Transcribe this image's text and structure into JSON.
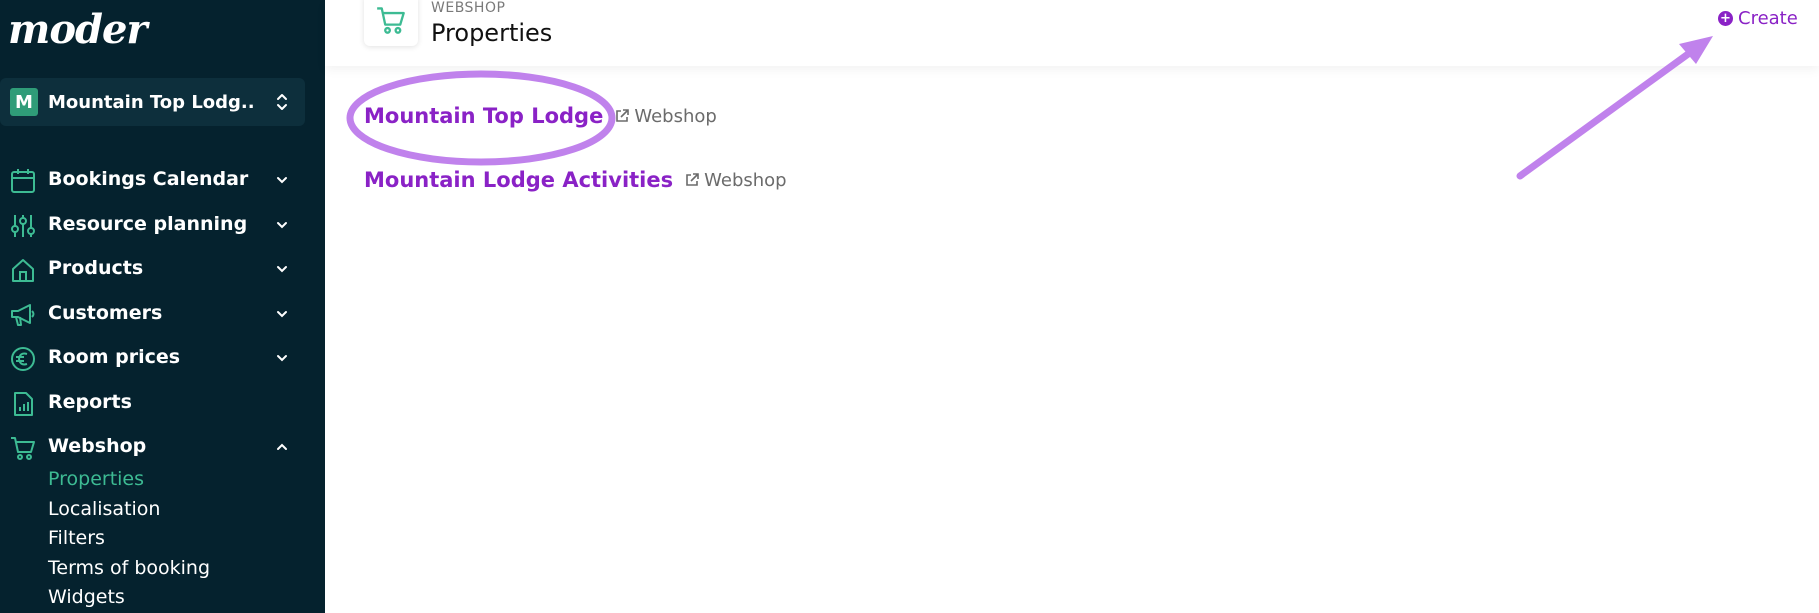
{
  "sidebar": {
    "logo": "moder",
    "property_switcher": {
      "avatar_letter": "M",
      "name": "Mountain Top Lodg..."
    },
    "items": [
      {
        "label": "Bookings Calendar",
        "icon": "calendar-icon",
        "expandable": true,
        "expanded": false
      },
      {
        "label": "Resource planning",
        "icon": "sliders-icon",
        "expandable": true,
        "expanded": false
      },
      {
        "label": "Products",
        "icon": "home-icon",
        "expandable": true,
        "expanded": false
      },
      {
        "label": "Customers",
        "icon": "megaphone-icon",
        "expandable": true,
        "expanded": false
      },
      {
        "label": "Room prices",
        "icon": "euro-icon",
        "expandable": true,
        "expanded": false
      },
      {
        "label": "Reports",
        "icon": "report-icon",
        "expandable": false
      },
      {
        "label": "Webshop",
        "icon": "cart-icon",
        "expandable": true,
        "expanded": true
      }
    ],
    "webshop_subitems": [
      {
        "label": "Properties",
        "active": true
      },
      {
        "label": "Localisation",
        "active": false
      },
      {
        "label": "Filters",
        "active": false
      },
      {
        "label": "Terms of booking",
        "active": false
      },
      {
        "label": "Widgets",
        "active": false
      }
    ]
  },
  "header": {
    "section": "WEBSHOP",
    "title": "Properties",
    "icon": "cart-icon",
    "create_label": "Create"
  },
  "properties": [
    {
      "name": "Mountain Top Lodge",
      "webshop_label": "Webshop"
    },
    {
      "name": "Mountain Lodge Activities",
      "webshop_label": "Webshop"
    }
  ],
  "colors": {
    "sidebar_bg": "#05222e",
    "accent_green": "#3dbb93",
    "link_purple": "#8a22c6",
    "annotation_purple": "#c082ec"
  }
}
